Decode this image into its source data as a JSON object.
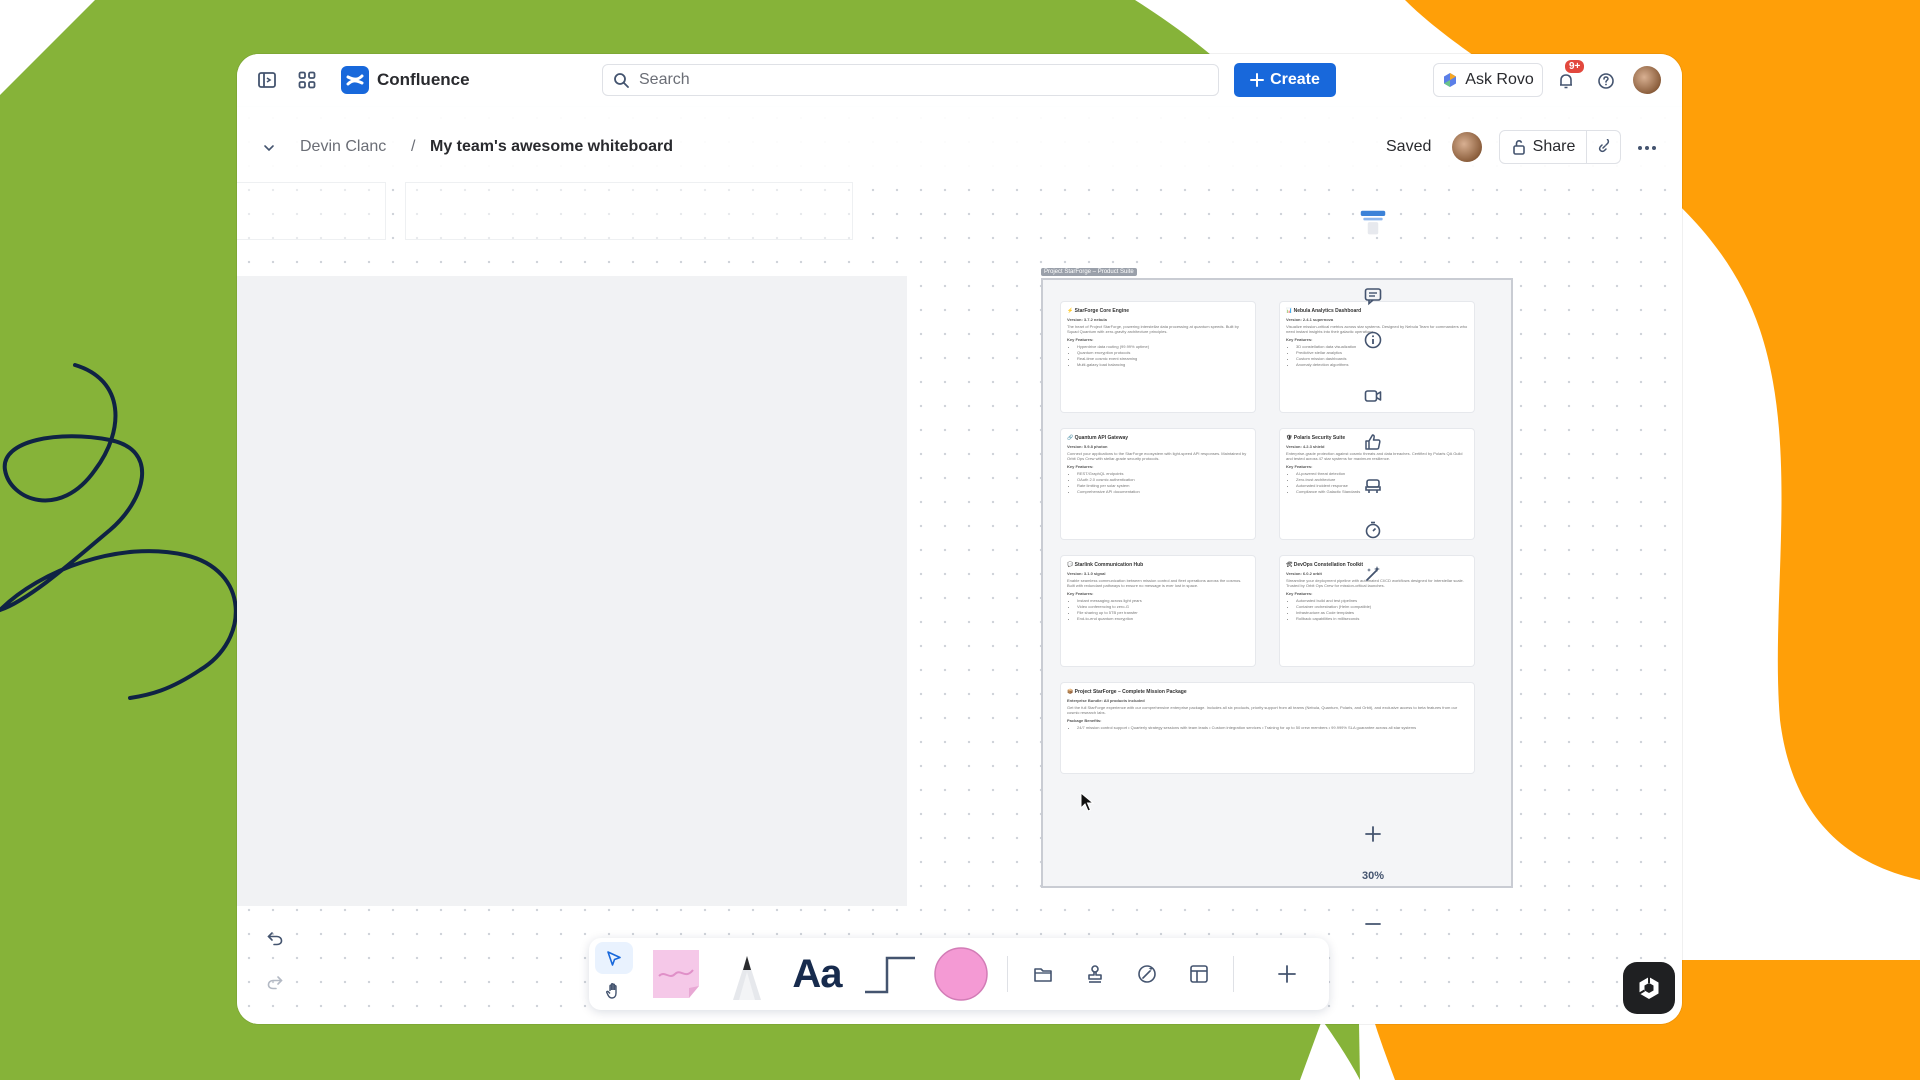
{
  "app": {
    "name": "Confluence",
    "search_placeholder": "Search",
    "create_label": "Create",
    "ask_rovo_label": "Ask Rovo",
    "notifications_badge": "9+"
  },
  "breadcrumb": {
    "parent": "Devin Clanc",
    "separator": "/",
    "current": "My team's awesome whiteboard"
  },
  "page_actions": {
    "status": "Saved",
    "share_label": "Share"
  },
  "frame": {
    "tag": "Project StarForge – Product Suite",
    "cards": [
      {
        "title": "⚡ StarForge Core Engine",
        "version": "Version: 3.7.2 nebula",
        "desc": "The heart of Project StarForge, powering interstellar data processing at quantum speeds. Built by Squad Quantum with zero-gravity architecture principles.",
        "features_label": "Key Features:",
        "features": [
          "Hyperdrive data routing (99.99% uptime)",
          "Quantum encryption protocols",
          "Real-time cosmic event streaming",
          "Multi-galaxy load balancing"
        ]
      },
      {
        "title": "📊 Nebula Analytics Dashboard",
        "version": "Version: 2.4.1 supernova",
        "desc": "Visualize mission-critical metrics across star systems. Designed by Nebula Team for commanders who need instant insights into their galactic operations.",
        "features_label": "Key Features:",
        "features": [
          "3D constellation data visualization",
          "Predictive stellar analytics",
          "Custom mission dashboards",
          "Anomaly detection algorithms"
        ]
      },
      {
        "title": "🔗 Quantum API Gateway",
        "version": "Version: 5.9.8 photon",
        "desc": "Connect your applications to the StarForge ecosystem with light-speed API responses. Maintained by Orbit Ops Crew with stellar-grade security protocols.",
        "features_label": "Key Features:",
        "features": [
          "REST/GraphQL endpoints",
          "OAuth 2.0 cosmic authentication",
          "Rate limiting per solar system",
          "Comprehensive API documentation"
        ]
      },
      {
        "title": "🛡 Polaris Security Suite",
        "version": "Version: 4.2.3 shield",
        "desc": "Enterprise-grade protection against cosmic threats and data breaches. Certified by Polaris QA Guild and tested across 47 star systems for maximum resilience.",
        "features_label": "Key Features:",
        "features": [
          "AI-powered threat detection",
          "Zero-trust architecture",
          "Automated incident response",
          "Compliance with Galactic Standards"
        ]
      },
      {
        "title": "💬 Starlink Communication Hub",
        "version": "Version: 3.1.0 signal",
        "desc": "Enable seamless communication between mission control and fleet operations across the cosmos. Built with redundant pathways to ensure no message is ever lost in space.",
        "features_label": "Key Features:",
        "features": [
          "Instant messaging across light years",
          "Video conferencing to zero-G",
          "File sharing up to 5TB per transfer",
          "End-to-end quantum encryption"
        ]
      },
      {
        "title": "🛠 DevOps Constellation Toolkit",
        "version": "Version: 6.0.2 orbit",
        "desc": "Streamline your deployment pipeline with automated CI/CD workflows designed for interstellar scale. Trusted by Orbit Ops Crew for mission-critical launches.",
        "features_label": "Key Features:",
        "features": [
          "Automated build and test pipelines",
          "Container orchestration (Helm compatible)",
          "Infrastructure as Code templates",
          "Rollback capabilities in milliseconds"
        ]
      },
      {
        "title": "📦 Project StarForge – Complete Mission Package",
        "version": "Enterprise Bundle: All products included",
        "desc": "Get the full StarForge experience with our comprehensive enterprise package. Includes all six products, priority support from all teams (Nebula, Quantum, Polaris, and Orbit), and exclusive access to beta features from our cosmic research labs.",
        "features_label": "Package Benefits:",
        "features": [
          "24/7 mission control support • Quarterly strategy sessions with team leads • Custom integration services • Training for up to 50 crew members • 99.999% SLA guarantee across all star systems"
        ]
      }
    ]
  },
  "zoom": "30%",
  "toolbar": {
    "text_tool_label": "Aa",
    "sticky_color": "#f5c8e8",
    "shape_color": "#f49ad4"
  },
  "colors": {
    "brand": "#1868db",
    "bg_green": "#86b339",
    "bg_orange": "#ff9f08",
    "scribble": "#0f2344"
  }
}
